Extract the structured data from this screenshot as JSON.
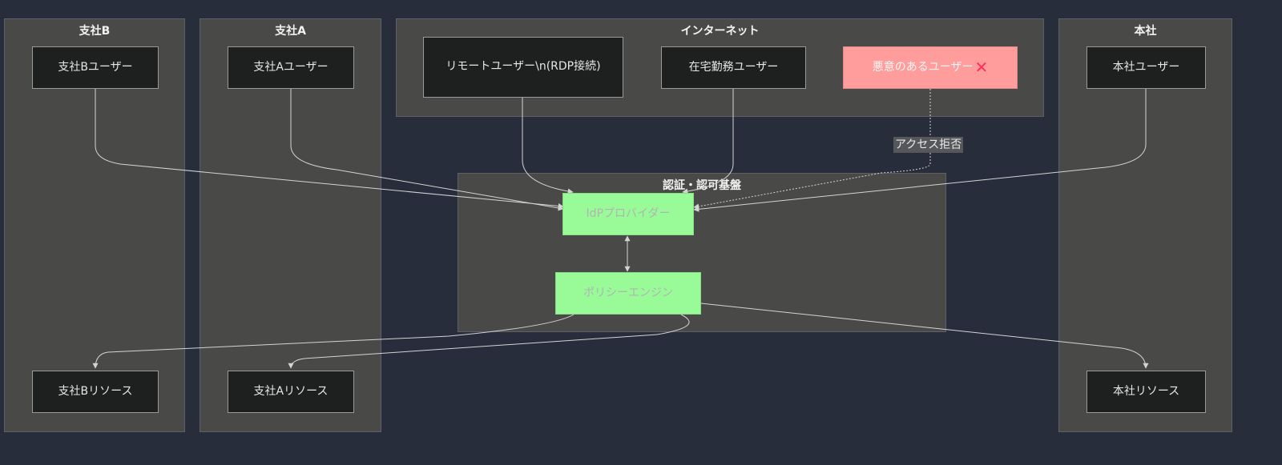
{
  "clusters": {
    "branch_b": {
      "title": "支社B"
    },
    "branch_a": {
      "title": "支社A"
    },
    "internet": {
      "title": "インターネット"
    },
    "hq": {
      "title": "本社"
    },
    "auth": {
      "title": "認証・認可基盤"
    }
  },
  "nodes": {
    "branch_b_user": "支社Bユーザー",
    "branch_a_user": "支社Aユーザー",
    "remote_user": "リモートユーザー\\n(RDP接続)",
    "home_user": "在宅勤務ユーザー",
    "malicious_user": "悪意のあるユーザー",
    "malicious_mark": "✕",
    "hq_user": "本社ユーザー",
    "idp": "IdPプロバイダー",
    "policy_engine": "ポリシーエンジン",
    "branch_b_resource": "支社Bリソース",
    "branch_a_resource": "支社Aリソース",
    "hq_resource": "本社リソース"
  },
  "edge_labels": {
    "access_denied": "アクセス拒否"
  },
  "colors": {
    "background": "#272d3b",
    "cluster": "#494a48",
    "node": "#1e201f",
    "auth_node": "#98fb98",
    "malicious_node": "#ff9c9c",
    "deny_mark": "#ff2e5a",
    "edge": "#d4d4d4"
  }
}
